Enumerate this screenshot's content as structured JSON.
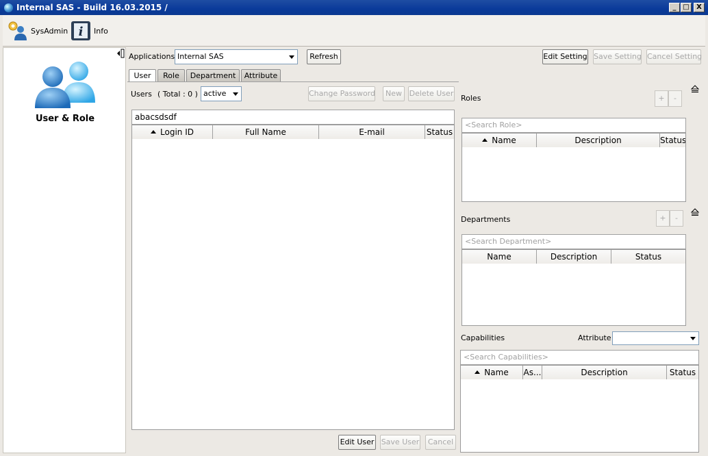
{
  "window": {
    "title": "Internal SAS - Build 16.03.2015 /",
    "minimize": "_",
    "maximize": "□",
    "close": "X"
  },
  "toolbar": {
    "sysadmin_label": "SysAdmin",
    "info_label": "Info"
  },
  "sidebar": {
    "title": "User & Role"
  },
  "header": {
    "applications_label": "Applications:",
    "application_selected": "Internal SAS",
    "refresh_label": "Refresh",
    "edit_setting_label": "Edit Setting",
    "save_setting_label": "Save Setting",
    "cancel_setting_label": "Cancel Setting"
  },
  "tabs": [
    {
      "label": "User",
      "active": true
    },
    {
      "label": "Role",
      "active": false
    },
    {
      "label": "Department",
      "active": false
    },
    {
      "label": "Attribute",
      "active": false
    }
  ],
  "users": {
    "label": "Users",
    "total_text": "( Total : 0 )",
    "status_filter": "active",
    "change_password_label": "Change Password",
    "new_label": "New",
    "delete_user_label": "Delete User",
    "search_value": "abacsdsdf",
    "columns": [
      "Login ID",
      "Full Name",
      "E-mail",
      "Status"
    ],
    "rows": [],
    "edit_user_label": "Edit User",
    "save_user_label": "Save User",
    "cancel_label": "Cancel"
  },
  "roles": {
    "label": "Roles",
    "add": "+",
    "remove": "-",
    "search_placeholder": "<Search Role>",
    "columns": [
      "Name",
      "Description",
      "Status"
    ]
  },
  "departments": {
    "label": "Departments",
    "add": "+",
    "remove": "-",
    "search_placeholder": "<Search Department>",
    "columns": [
      "Name",
      "Description",
      "Status"
    ]
  },
  "capabilities": {
    "label": "Capabilities",
    "attribute_label": "Attribute",
    "attribute_value": "",
    "search_placeholder": "<Search Capabilities>",
    "columns": [
      "Name",
      "As...",
      "Description",
      "Status"
    ]
  }
}
